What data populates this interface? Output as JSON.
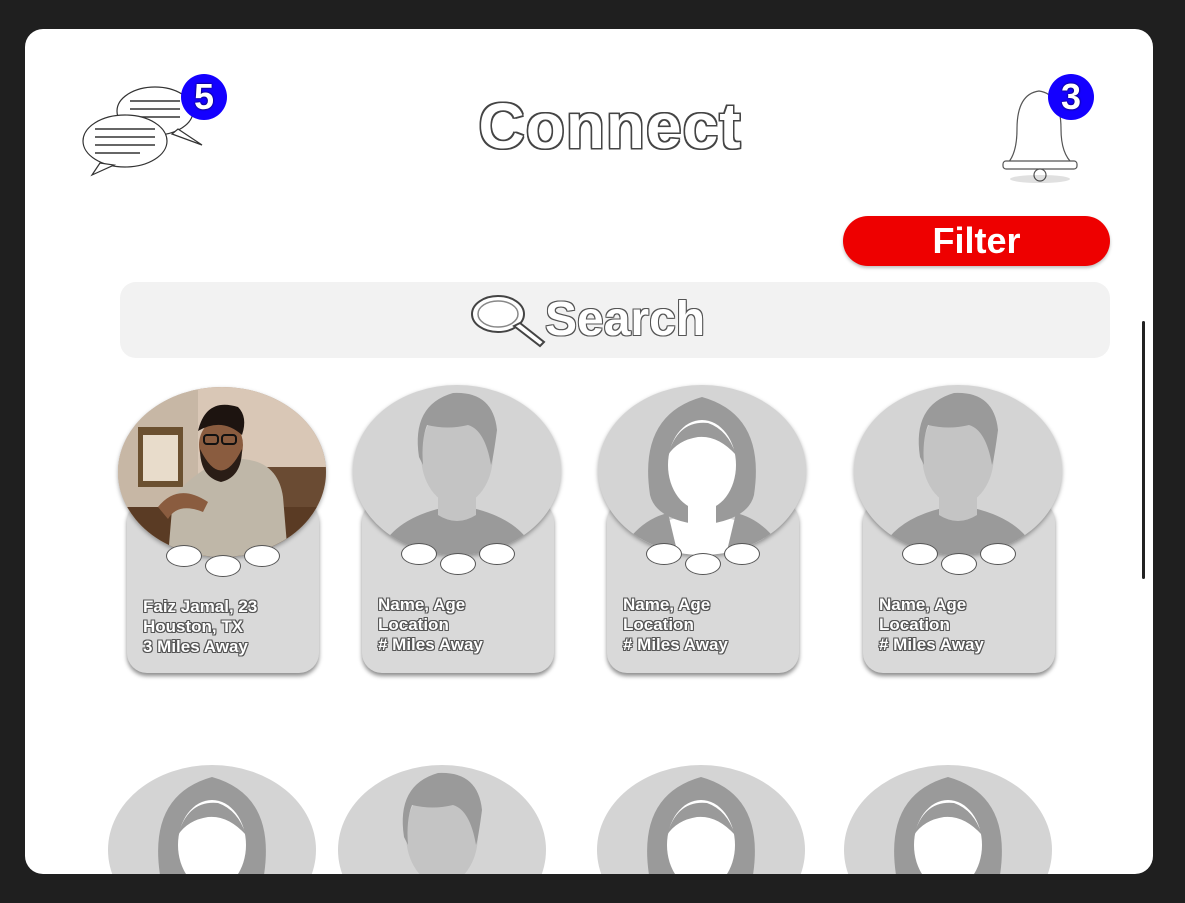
{
  "header": {
    "title": "Connect",
    "messages_badge": "5",
    "notifications_badge": "3"
  },
  "filter": {
    "label": "Filter"
  },
  "search": {
    "label": "Search"
  },
  "profiles": [
    {
      "line1": "Faiz Jamal, 23",
      "line2": "Houston, TX",
      "line3": "3 Miles Away"
    },
    {
      "line1": "Name, Age",
      "line2": "Location",
      "line3": "# Miles Away"
    },
    {
      "line1": "Name, Age",
      "line2": "Location",
      "line3": "# Miles Away"
    },
    {
      "line1": "Name, Age",
      "line2": "Location",
      "line3": "# Miles Away"
    }
  ],
  "colors": {
    "badge": "#1400ff",
    "filter": "#ee0000",
    "card": "#d9d9d9",
    "search_bg": "#f2f2f2"
  }
}
